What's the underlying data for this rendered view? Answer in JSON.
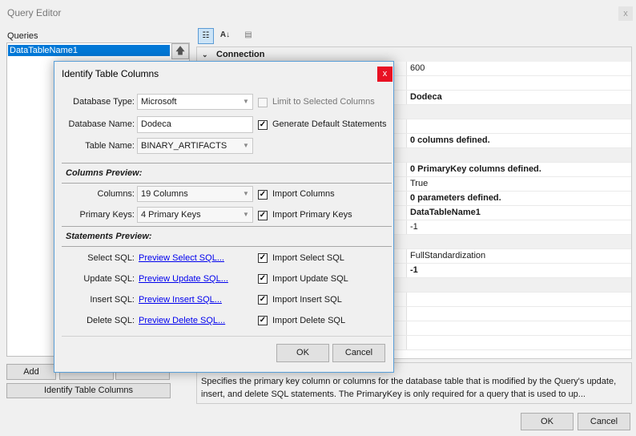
{
  "window": {
    "title": "Query Editor",
    "close_glyph": "x",
    "queries_label": "Queries",
    "queries": [
      "DataTableName1"
    ],
    "move_up_glyph": "🡅",
    "add_label": "Add",
    "identify_label": "Identify Table Columns",
    "ok_label": "OK",
    "cancel_label": "Cancel"
  },
  "grid": {
    "toolbar_icons": [
      "categorized-icon",
      "alphabetical-sort-icon",
      "property-pages-icon"
    ],
    "alpha_glyph": "A↓",
    "category": "Connection",
    "rows": [
      {
        "value": "600",
        "bold": false,
        "cat": false
      },
      {
        "value": "",
        "bold": false,
        "cat": false
      },
      {
        "value": "Dodeca",
        "bold": true,
        "cat": false
      },
      {
        "value": "",
        "bold": false,
        "cat": true
      },
      {
        "value": "",
        "bold": false,
        "cat": false
      },
      {
        "value": "0 columns defined.",
        "bold": true,
        "cat": false
      },
      {
        "value": "",
        "bold": false,
        "cat": true
      },
      {
        "value": "0 PrimaryKey columns defined.",
        "bold": true,
        "cat": false
      },
      {
        "value": "True",
        "bold": false,
        "cat": false
      },
      {
        "value": "0 parameters defined.",
        "bold": true,
        "cat": false
      },
      {
        "value": "DataTableName1",
        "bold": true,
        "cat": false
      },
      {
        "value": "-1",
        "bold": false,
        "cat": false
      },
      {
        "value": "",
        "bold": false,
        "cat": true
      },
      {
        "value": "FullStandardization",
        "bold": false,
        "cat": false
      },
      {
        "value": "-1",
        "bold": true,
        "cat": false
      },
      {
        "value": "",
        "bold": false,
        "cat": true
      },
      {
        "value": "",
        "bold": false,
        "cat": false
      },
      {
        "value": "",
        "bold": false,
        "cat": false
      },
      {
        "value": "",
        "bold": false,
        "cat": false
      },
      {
        "value": "",
        "bold": false,
        "cat": false
      }
    ],
    "description": "Specifies the primary key column or columns for the database table that is modified by the Query's update, insert, and delete SQL statements.  The PrimaryKey is only required for a query that is used to up..."
  },
  "dialog": {
    "title": "Identify Table Columns",
    "close_glyph": "x",
    "database_type_label": "Database Type:",
    "database_type_value": "Microsoft",
    "database_name_label": "Database Name:",
    "database_name_value": "Dodeca",
    "table_name_label": "Table Name:",
    "table_name_value": "BINARY_ARTIFACTS",
    "limit_label": "Limit to Selected Columns",
    "generate_label": "Generate Default Statements",
    "columns_preview_title": "Columns Preview:",
    "columns_label": "Columns:",
    "columns_value": "19 Columns",
    "import_columns_label": "Import Columns",
    "primary_keys_label": "Primary Keys:",
    "primary_keys_value": "4 Primary Keys",
    "import_primary_keys_label": "Import Primary Keys",
    "statements_preview_title": "Statements Preview:",
    "statements": [
      {
        "label": "Select SQL:",
        "link": "Preview Select SQL...",
        "import": "Import Select SQL"
      },
      {
        "label": "Update SQL:",
        "link": "Preview Update SQL...",
        "import": "Import Update SQL"
      },
      {
        "label": "Insert SQL:",
        "link": "Preview Insert SQL...",
        "import": "Import Insert SQL"
      },
      {
        "label": "Delete SQL:",
        "link": "Preview Delete SQL...",
        "import": "Import Delete SQL"
      }
    ],
    "check_glyph": "✓",
    "arrow_glyph": "▼",
    "ok_label": "OK",
    "cancel_label": "Cancel",
    "checks": {
      "limit": false,
      "generate": true,
      "import_columns": true,
      "import_primary_keys": true,
      "select": true,
      "update": true,
      "insert": true,
      "delete": true
    }
  }
}
